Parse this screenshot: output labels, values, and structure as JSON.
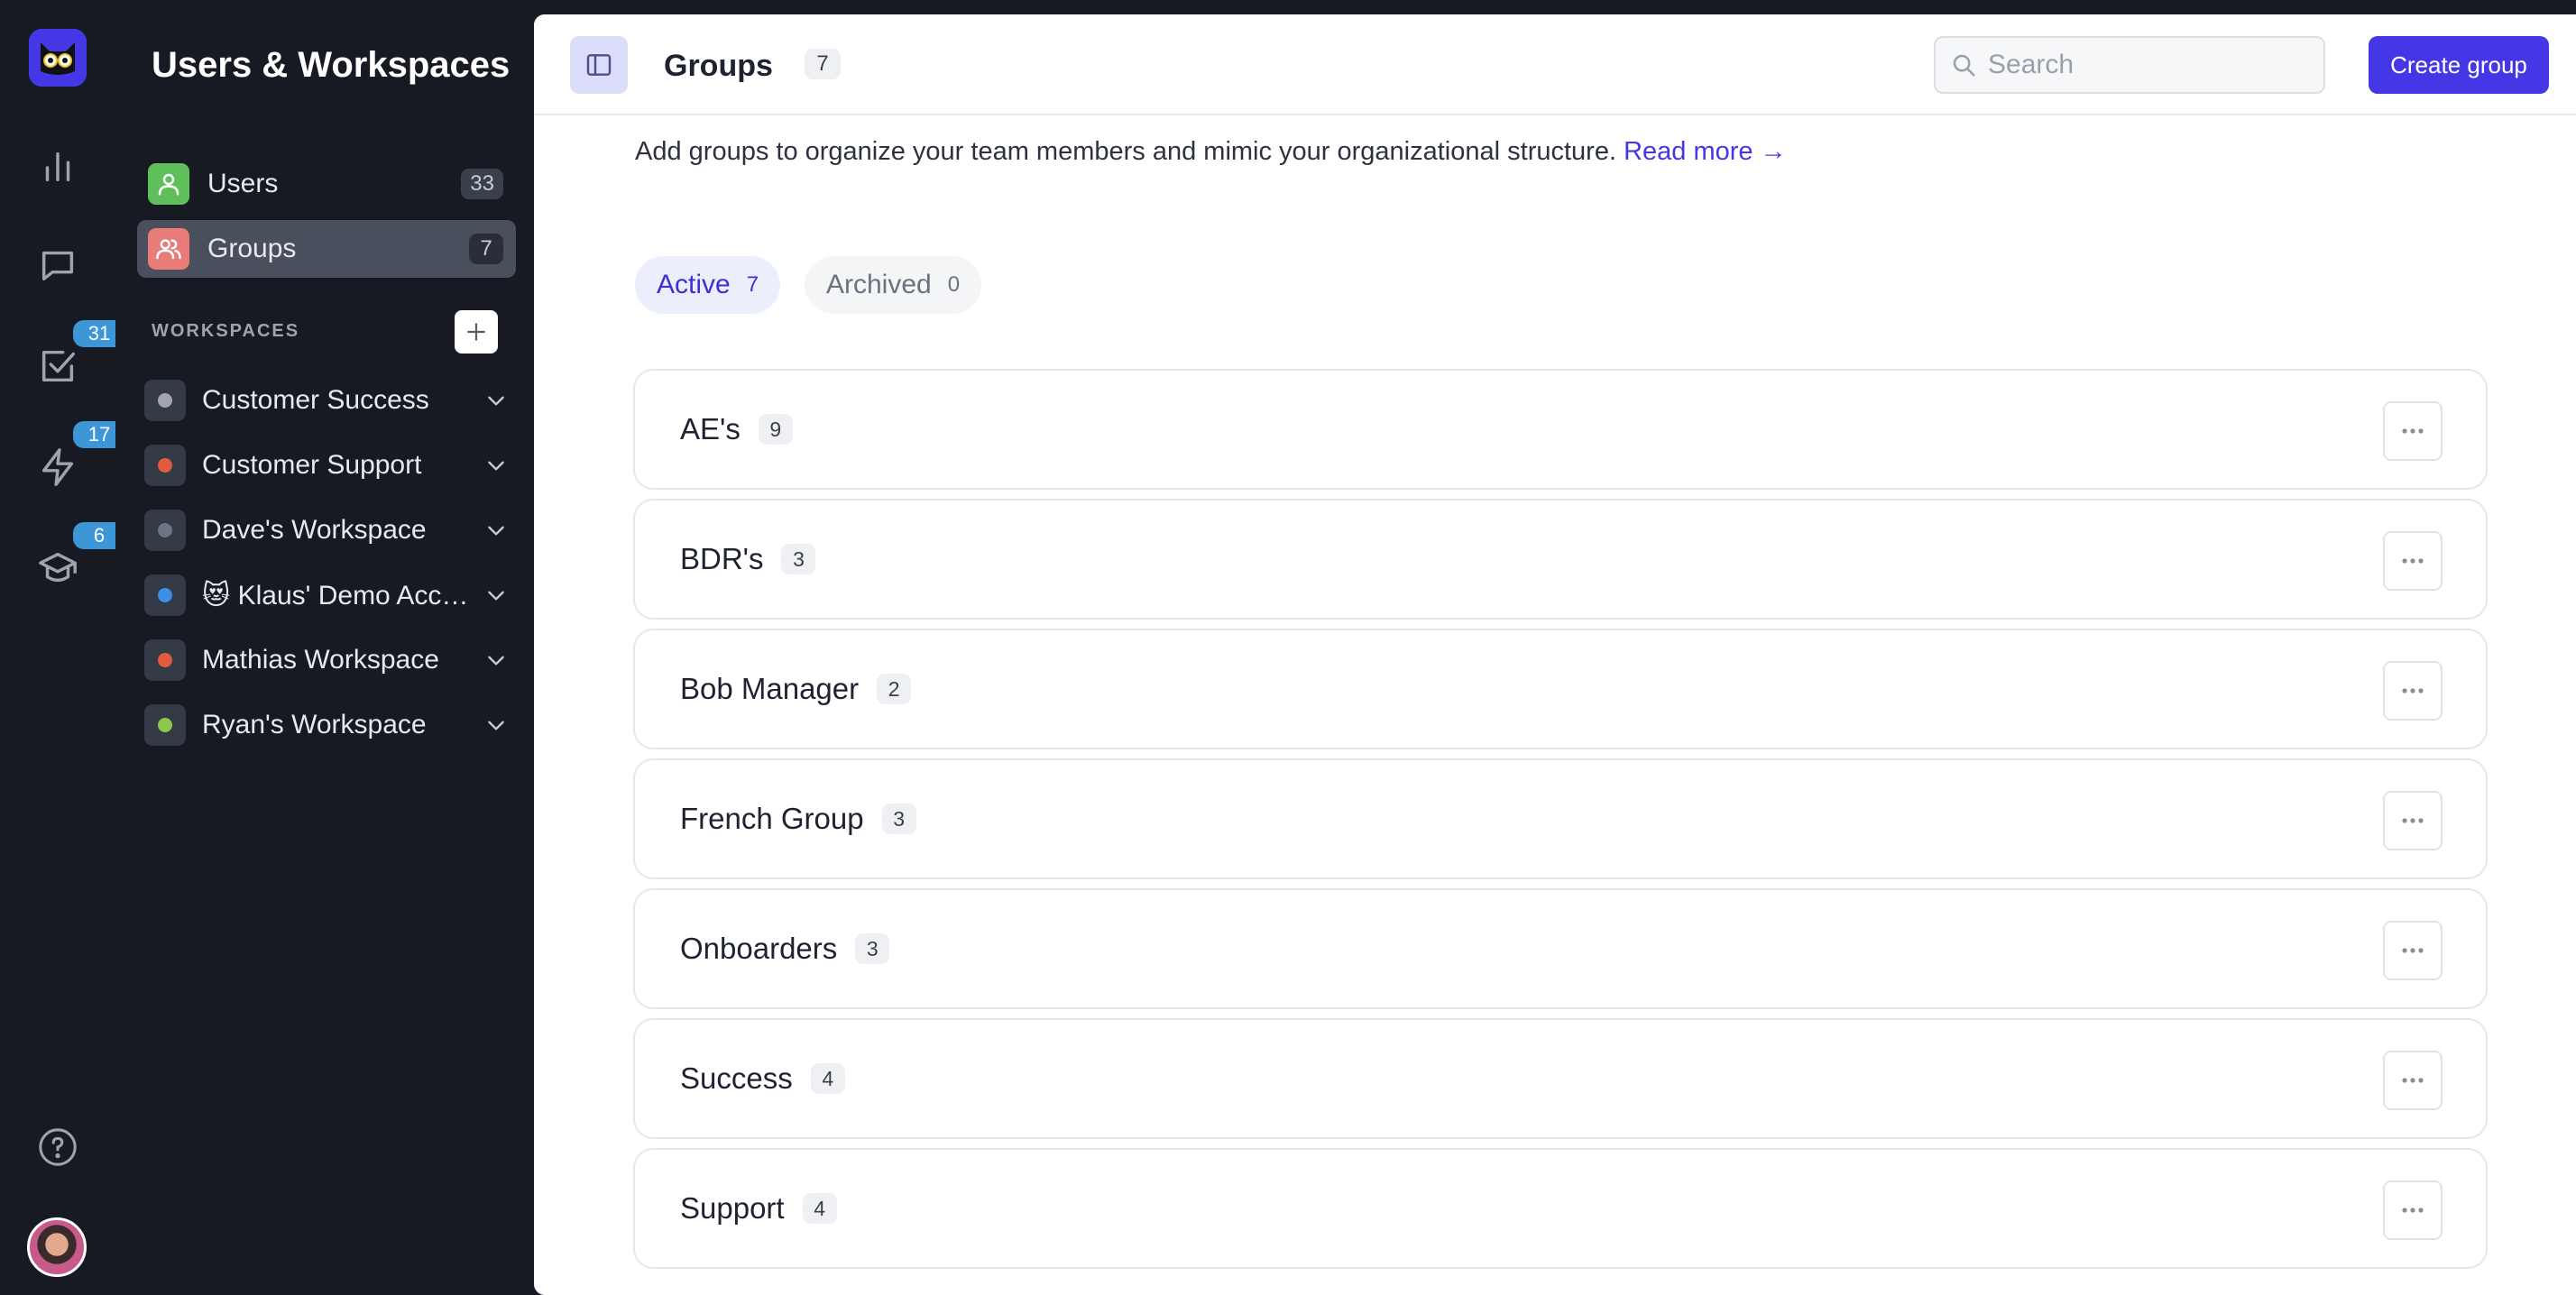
{
  "app": {
    "sidebar_title": "Users & Workspaces"
  },
  "rail": {
    "items": [
      {
        "icon": "bar-chart-icon",
        "badge": ""
      },
      {
        "icon": "chat-bubble-icon",
        "badge": ""
      },
      {
        "icon": "checkbox-icon",
        "badge": "31"
      },
      {
        "icon": "lightning-icon",
        "badge": "17"
      },
      {
        "icon": "graduation-cap-icon",
        "badge": "6"
      }
    ],
    "help_icon": "help-circle-icon",
    "avatar_icon": "user-avatar"
  },
  "nav": {
    "users": {
      "label": "Users",
      "count": "33",
      "color": "#5fbf5a"
    },
    "groups": {
      "label": "Groups",
      "count": "7",
      "color": "#e97b78"
    }
  },
  "workspaces": {
    "header": "WORKSPACES",
    "items": [
      {
        "label": "Customer Success",
        "dot_color": "#a2a6b0"
      },
      {
        "label": "Customer Support",
        "dot_color": "#e25a3e"
      },
      {
        "label": "Dave's Workspace",
        "dot_color": "#6b7585"
      },
      {
        "label": "😻 Klaus' Demo Acc…",
        "dot_color": "#3d8ee6"
      },
      {
        "label": "Mathias Workspace",
        "dot_color": "#e25a3e"
      },
      {
        "label": "Ryan's Workspace",
        "dot_color": "#8ac94e"
      }
    ]
  },
  "header": {
    "title": "Groups",
    "count": "7",
    "search_placeholder": "Search",
    "create_label": "Create group"
  },
  "intro": {
    "text": "Add groups to organize your team members and mimic your organizational structure.",
    "link": "Read more →"
  },
  "tabs": [
    {
      "label": "Active",
      "count": "7"
    },
    {
      "label": "Archived",
      "count": "0"
    }
  ],
  "groups": [
    {
      "name": "AE's",
      "count": "9"
    },
    {
      "name": "BDR's",
      "count": "3"
    },
    {
      "name": "Bob Manager",
      "count": "2"
    },
    {
      "name": "French Group",
      "count": "3"
    },
    {
      "name": "Onboarders",
      "count": "3"
    },
    {
      "name": "Success",
      "count": "4"
    },
    {
      "name": "Support",
      "count": "4"
    }
  ],
  "colors": {
    "accent": "#4537e6",
    "sidebar_bg": "#171a23",
    "badge_blue": "#3d96d8"
  }
}
